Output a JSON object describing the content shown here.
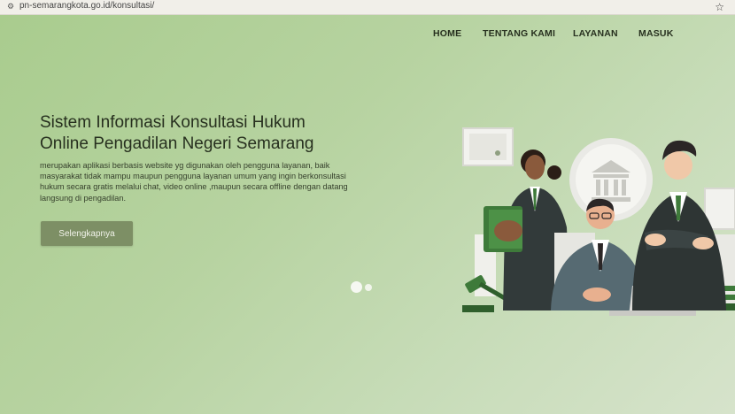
{
  "browser": {
    "url": "pn-semarangkota.go.id/konsultasi/",
    "site_icon": "tune-icon",
    "bookmark_icon": "star-icon"
  },
  "nav": {
    "items": [
      {
        "label": "HOME"
      },
      {
        "label": "TENTANG KAMI"
      },
      {
        "label": "LAYANAN"
      },
      {
        "label": "MASUK"
      }
    ]
  },
  "hero": {
    "title_line1": "Sistem Informasi Konsultasi Hukum",
    "title_line2": "Online Pengadilan Negeri Semarang",
    "description": "merupakan aplikasi berbasis website yg digunakan oleh pengguna layanan, baik masyarakat tidak mampu maupun pengguna layanan umum yang ingin berkonsultasi hukum secara gratis melalui chat, video online ,maupun secara offline dengan datang langsung di pengadilan.",
    "cta_label": "Selengkapnya",
    "slide_count": 2,
    "active_slide": 1
  },
  "colors": {
    "background": "#b9d4a6",
    "button": "#7d8f65",
    "text_dark": "#27301f",
    "suit_dark": "#2e3534",
    "accent_green": "#3e7a3a"
  }
}
